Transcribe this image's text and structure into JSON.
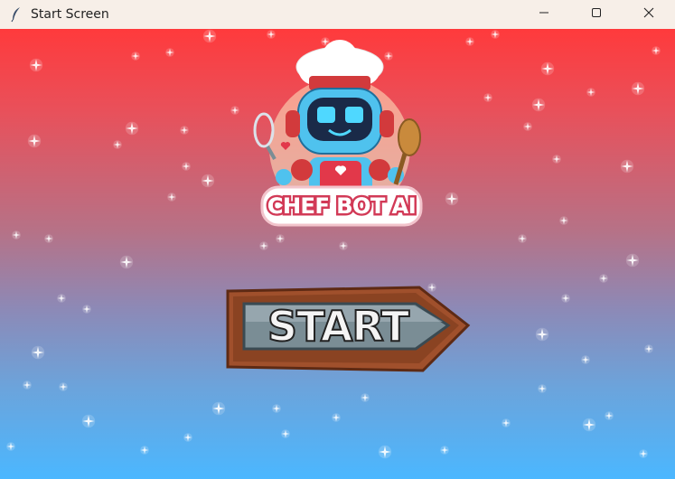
{
  "window": {
    "title": "Start Screen",
    "icon": "feather-icon",
    "controls": [
      "minimize-icon",
      "maximize-icon",
      "close-icon"
    ]
  },
  "logo": {
    "text": "CHEF BOT AI",
    "icon": "chef-robot-icon"
  },
  "start_button": {
    "label": "START"
  },
  "colors": {
    "gradient_top": "#ff3a3c",
    "gradient_bottom": "#4bb7ff",
    "titlebar": "#f7efe8",
    "sign_wood": "#a0502c",
    "sign_plate": "#7a8d95"
  }
}
